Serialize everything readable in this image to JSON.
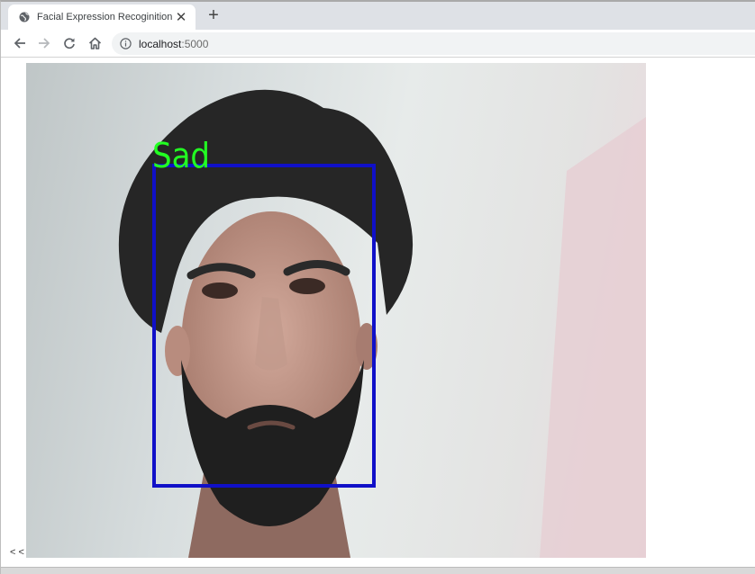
{
  "browser": {
    "tab_title": "Facial Expression Recoginition",
    "tab_close_glyph": "✕",
    "new_tab_glyph": "+",
    "url_host": "localhost",
    "url_port": ":5000"
  },
  "detection": {
    "label": "Sad",
    "label_color": "#22ff22",
    "box_color": "#1010c8"
  },
  "page": {
    "footer_text": "< <"
  }
}
